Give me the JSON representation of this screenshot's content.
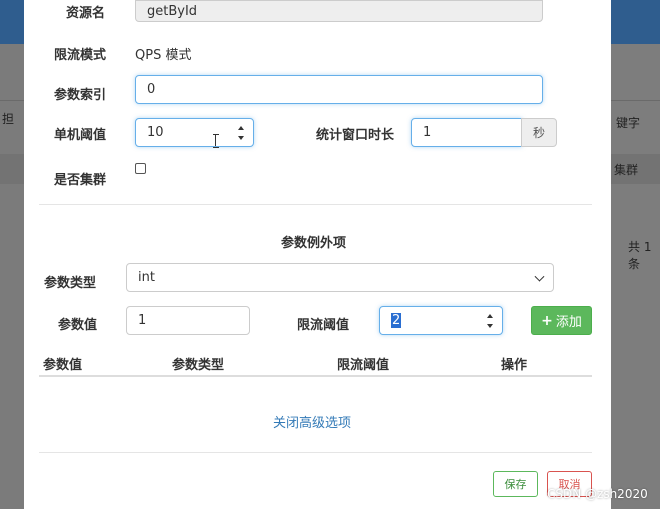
{
  "background": {
    "left_partial": "担",
    "right_keyword": "键字",
    "right_cluster": "集群",
    "right_total": "共 1 条"
  },
  "form": {
    "resource_name_label": "资源名",
    "resource_name_value": "getById",
    "flow_mode_label": "限流模式",
    "flow_mode_value": "QPS 模式",
    "param_index_label": "参数索引",
    "param_index_value": "0",
    "threshold_label": "单机阈值",
    "threshold_value": "10",
    "window_label": "统计窗口时长",
    "window_value": "1",
    "window_unit": "秒",
    "cluster_label": "是否集群"
  },
  "exceptions": {
    "section_title": "参数例外项",
    "param_type_label": "参数类型",
    "param_type_value": "int",
    "param_value_label": "参数值",
    "param_value_value": "1",
    "limit_label": "限流阈值",
    "limit_value": "2",
    "add_button": "添加",
    "table_headers": [
      "参数值",
      "参数类型",
      "限流阈值",
      "操作"
    ]
  },
  "advanced_link": "关闭高级选项",
  "footer": {
    "save": "保存",
    "cancel": "取消"
  },
  "watermark": "CSDN @zsh2020",
  "colors": {
    "header_blue": "#2f5d8e",
    "focus_border": "#66afe9",
    "success": "#5cb85c",
    "danger": "#d9534f",
    "link": "#337ab7"
  }
}
